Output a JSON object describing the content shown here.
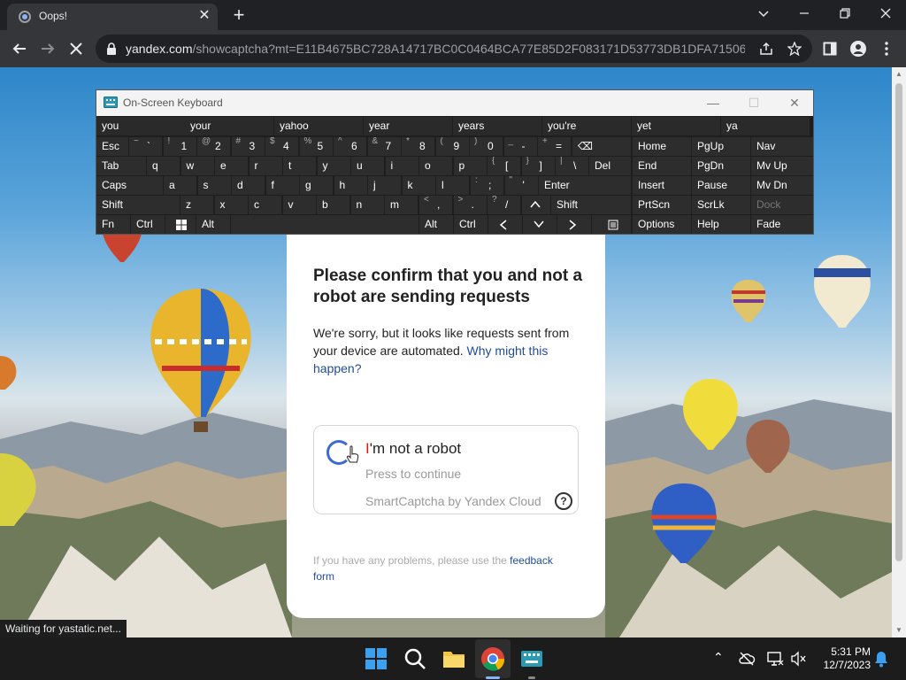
{
  "browser": {
    "tab_title": "Oops!",
    "url_host": "yandex.com",
    "url_rest": "/showcaptcha?mt=E11B4675BC728A14717BC0C0464BCA77E85D2F083171D53773DB1DFA71506651...",
    "status": "Waiting for yastatic.net..."
  },
  "osk": {
    "title": "On-Screen Keyboard",
    "predictions": [
      "you",
      "your",
      "yahoo",
      "year",
      "years",
      "you're",
      "yet",
      "ya"
    ],
    "row1": [
      {
        "shift": "~",
        "main": "`"
      },
      {
        "shift": "!",
        "main": "1"
      },
      {
        "shift": "@",
        "main": "2"
      },
      {
        "shift": "#",
        "main": "3"
      },
      {
        "shift": "$",
        "main": "4"
      },
      {
        "shift": "%",
        "main": "5"
      },
      {
        "shift": "^",
        "main": "6"
      },
      {
        "shift": "&",
        "main": "7"
      },
      {
        "shift": "*",
        "main": "8"
      },
      {
        "shift": "(",
        "main": "9"
      },
      {
        "shift": ")",
        "main": "0"
      },
      {
        "shift": "_",
        "main": "-"
      },
      {
        "shift": "+",
        "main": "="
      }
    ],
    "row2_letters": [
      "q",
      "w",
      "e",
      "r",
      "t",
      "y",
      "u",
      "i",
      "o",
      "p"
    ],
    "row2_sym": [
      {
        "shift": "{",
        "main": "["
      },
      {
        "shift": "}",
        "main": "]"
      },
      {
        "shift": "|",
        "main": "\\"
      }
    ],
    "row3_letters": [
      "a",
      "s",
      "d",
      "f",
      "g",
      "h",
      "j",
      "k",
      "l"
    ],
    "row3_sym": [
      {
        "shift": ":",
        "main": ";"
      },
      {
        "shift": "\"",
        "main": "'"
      }
    ],
    "row4_letters": [
      "z",
      "x",
      "c",
      "v",
      "b",
      "n",
      "m"
    ],
    "row4_sym": [
      {
        "shift": "<",
        "main": ","
      },
      {
        "shift": ">",
        "main": "."
      },
      {
        "shift": "?",
        "main": "/"
      }
    ],
    "keys": {
      "esc": "Esc",
      "tab": "Tab",
      "caps": "Caps",
      "shift": "Shift",
      "fn": "Fn",
      "ctrl": "Ctrl",
      "alt": "Alt",
      "del": "Del",
      "enter": "Enter",
      "backspace": "⌫"
    },
    "nav_keys": [
      [
        "Home",
        "PgUp",
        "Nav"
      ],
      [
        "End",
        "PgDn",
        "Mv Up"
      ],
      [
        "Insert",
        "Pause",
        "Mv Dn"
      ],
      [
        "PrtScn",
        "ScrLk",
        "Dock"
      ],
      [
        "Options",
        "Help",
        "Fade"
      ]
    ]
  },
  "captcha": {
    "title": "Please confirm that you and not a robot are sending requests",
    "text": "We're sorry, but it looks like requests sent from your device are automated.",
    "why_link": "Why might this happen?",
    "checkbox_label_prefix": "I",
    "checkbox_label_rest": "'m not a robot",
    "press_continue": "Press to continue",
    "provider": "SmartCaptcha by Yandex Cloud",
    "help": "?",
    "feedback_text": "If you have any problems, please use the",
    "feedback_link": "feedback form"
  },
  "taskbar": {
    "time": "5:31 PM",
    "date": "12/7/2023"
  }
}
